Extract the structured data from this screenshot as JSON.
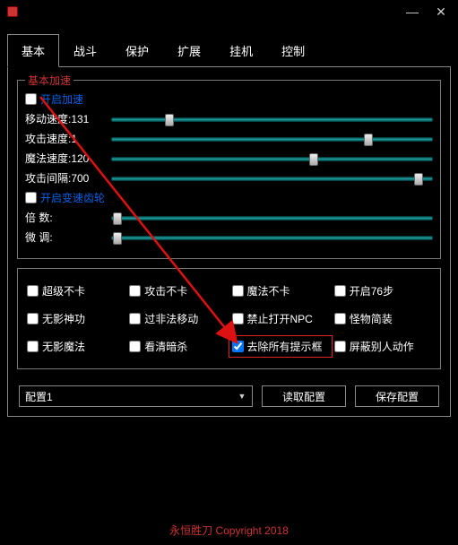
{
  "titlebar": {
    "icon": "app-icon"
  },
  "wincontrols": {
    "minimize": "—",
    "close": "✕"
  },
  "tabs": {
    "items": [
      {
        "label": "基本",
        "active": true
      },
      {
        "label": "战斗"
      },
      {
        "label": "保护"
      },
      {
        "label": "扩展"
      },
      {
        "label": "挂机"
      },
      {
        "label": "控制"
      }
    ]
  },
  "group1": {
    "title": "基本加速",
    "enable_accel": {
      "label": "开启加速",
      "checked": false
    },
    "sliders": [
      {
        "label": "移动速度:131",
        "pos": 0.18
      },
      {
        "label": "攻击速度:1",
        "pos": 0.8
      },
      {
        "label": "魔法速度:120",
        "pos": 0.63
      },
      {
        "label": "攻击间隔:700",
        "pos": 0.955
      }
    ],
    "enable_gear": {
      "label": "开启变速齿轮",
      "checked": false
    },
    "sliders2": [
      {
        "label": "倍   数:",
        "pos": 0.02
      },
      {
        "label": "微   调:",
        "pos": 0.02
      }
    ]
  },
  "options": {
    "items": [
      {
        "label": "超级不卡",
        "checked": false
      },
      {
        "label": "攻击不卡",
        "checked": false
      },
      {
        "label": "魔法不卡",
        "checked": false
      },
      {
        "label": "开启76步",
        "checked": false
      },
      {
        "label": "无影神功",
        "checked": false
      },
      {
        "label": "过非法移动",
        "checked": false
      },
      {
        "label": "禁止打开NPC",
        "checked": false
      },
      {
        "label": "怪物简装",
        "checked": false
      },
      {
        "label": "无影魔法",
        "checked": false
      },
      {
        "label": "看清暗杀",
        "checked": false
      },
      {
        "label": "去除所有提示框",
        "checked": true,
        "highlight": true
      },
      {
        "label": "屏蔽别人动作",
        "checked": false
      }
    ]
  },
  "bottom": {
    "config_name": "配置1",
    "load_btn": "读取配置",
    "save_btn": "保存配置"
  },
  "footer": {
    "text": "永恒胜刀   Copyright 2018"
  },
  "annotation": {
    "arrow": true
  }
}
